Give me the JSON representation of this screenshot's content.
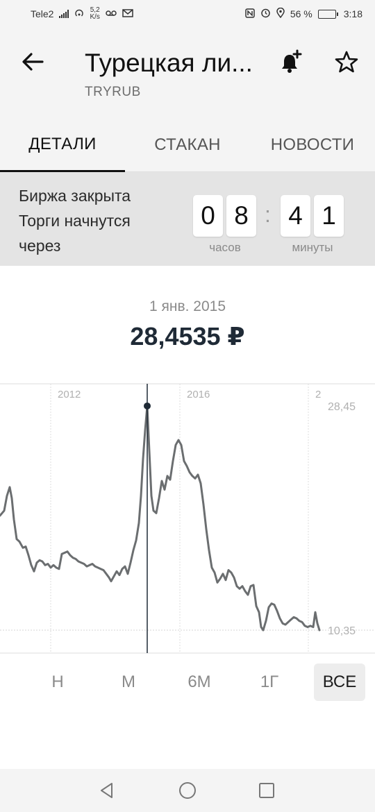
{
  "status_bar": {
    "carrier": "Tele2",
    "data_speed_value": "5,2",
    "data_speed_unit": "K/s",
    "battery": "56 %",
    "battery_level": 0.56,
    "time": "3:18"
  },
  "header": {
    "title": "Турецкая ли...",
    "ticker": "TRYRUB"
  },
  "tabs": [
    {
      "label": "ДЕТАЛИ",
      "active": true
    },
    {
      "label": "СТАКАН",
      "active": false
    },
    {
      "label": "НОВОСТИ",
      "active": false
    }
  ],
  "market": {
    "line1": "Биржа закрыта",
    "line2": "Торги начнутся",
    "line3": "через",
    "hours_digits": [
      "0",
      "8"
    ],
    "minutes_digits": [
      "4",
      "1"
    ],
    "separator": ":",
    "hours_label": "часов",
    "minutes_label": "минуты"
  },
  "price": {
    "date": "1 янв. 2015",
    "value": "28,4535 ₽"
  },
  "chart_data": {
    "type": "line",
    "x_ticks": [
      "2012",
      "2016",
      "2"
    ],
    "y_max_label": "28,45",
    "y_min_label": "10,35",
    "ylim": [
      10.35,
      28.45
    ],
    "selected_point": {
      "date": "1 янв. 2015",
      "value": 28.4535
    },
    "line_color": "#6b6e70",
    "points": [
      [
        0,
        19.6
      ],
      [
        6,
        20.0
      ],
      [
        10,
        21.2
      ],
      [
        14,
        21.9
      ],
      [
        17,
        21.0
      ],
      [
        20,
        19.3
      ],
      [
        24,
        17.7
      ],
      [
        28,
        17.5
      ],
      [
        33,
        17.0
      ],
      [
        37,
        17.1
      ],
      [
        41,
        16.4
      ],
      [
        45,
        15.6
      ],
      [
        49,
        15.1
      ],
      [
        53,
        15.8
      ],
      [
        57,
        16.0
      ],
      [
        61,
        15.9
      ],
      [
        65,
        15.6
      ],
      [
        69,
        15.7
      ],
      [
        73,
        15.4
      ],
      [
        77,
        15.6
      ],
      [
        81,
        15.4
      ],
      [
        85,
        15.3
      ],
      [
        89,
        16.5
      ],
      [
        93,
        16.6
      ],
      [
        97,
        16.7
      ],
      [
        101,
        16.4
      ],
      [
        105,
        16.2
      ],
      [
        109,
        16.1
      ],
      [
        113,
        15.9
      ],
      [
        117,
        15.8
      ],
      [
        121,
        15.7
      ],
      [
        125,
        15.5
      ],
      [
        129,
        15.6
      ],
      [
        133,
        15.7
      ],
      [
        137,
        15.5
      ],
      [
        141,
        15.4
      ],
      [
        145,
        15.3
      ],
      [
        149,
        15.2
      ],
      [
        153,
        14.9
      ],
      [
        157,
        14.6
      ],
      [
        160,
        14.3
      ],
      [
        164,
        14.7
      ],
      [
        168,
        15.1
      ],
      [
        172,
        14.8
      ],
      [
        176,
        15.3
      ],
      [
        180,
        15.5
      ],
      [
        184,
        14.9
      ],
      [
        188,
        15.8
      ],
      [
        192,
        16.8
      ],
      [
        196,
        17.6
      ],
      [
        200,
        19.0
      ],
      [
        203,
        21.2
      ],
      [
        206,
        24.2
      ],
      [
        209,
        26.5
      ],
      [
        212,
        28.45
      ],
      [
        215,
        24.8
      ],
      [
        218,
        21.2
      ],
      [
        221,
        20.0
      ],
      [
        225,
        19.8
      ],
      [
        229,
        21.0
      ],
      [
        233,
        22.4
      ],
      [
        237,
        21.7
      ],
      [
        241,
        22.8
      ],
      [
        245,
        22.5
      ],
      [
        249,
        24.0
      ],
      [
        253,
        25.3
      ],
      [
        257,
        25.7
      ],
      [
        261,
        25.3
      ],
      [
        265,
        24.0
      ],
      [
        269,
        23.6
      ],
      [
        273,
        23.1
      ],
      [
        277,
        22.8
      ],
      [
        281,
        22.6
      ],
      [
        285,
        22.9
      ],
      [
        289,
        22.2
      ],
      [
        293,
        20.5
      ],
      [
        297,
        18.5
      ],
      [
        301,
        16.8
      ],
      [
        305,
        15.4
      ],
      [
        309,
        15.0
      ],
      [
        313,
        14.2
      ],
      [
        317,
        14.5
      ],
      [
        321,
        14.9
      ],
      [
        325,
        14.4
      ],
      [
        329,
        15.2
      ],
      [
        333,
        15.0
      ],
      [
        337,
        14.6
      ],
      [
        341,
        13.9
      ],
      [
        345,
        13.7
      ],
      [
        349,
        13.9
      ],
      [
        353,
        13.5
      ],
      [
        357,
        13.2
      ],
      [
        361,
        13.9
      ],
      [
        365,
        14.0
      ],
      [
        369,
        12.3
      ],
      [
        373,
        11.8
      ],
      [
        376,
        10.6
      ],
      [
        379,
        10.35
      ],
      [
        383,
        11.1
      ],
      [
        387,
        12.2
      ],
      [
        391,
        12.5
      ],
      [
        395,
        12.4
      ],
      [
        399,
        11.9
      ],
      [
        403,
        11.3
      ],
      [
        407,
        10.9
      ],
      [
        411,
        10.8
      ],
      [
        415,
        11.0
      ],
      [
        419,
        11.2
      ],
      [
        423,
        11.4
      ],
      [
        427,
        11.3
      ],
      [
        431,
        11.1
      ],
      [
        435,
        11.0
      ],
      [
        439,
        10.7
      ],
      [
        443,
        10.6
      ],
      [
        447,
        10.7
      ],
      [
        451,
        10.6
      ],
      [
        454,
        11.8
      ],
      [
        457,
        10.9
      ],
      [
        460,
        10.35
      ]
    ]
  },
  "ranges": [
    {
      "label": "Н",
      "active": false
    },
    {
      "label": "М",
      "active": false
    },
    {
      "label": "6М",
      "active": false
    },
    {
      "label": "1Г",
      "active": false
    },
    {
      "label": "ВСЕ",
      "active": true
    }
  ]
}
